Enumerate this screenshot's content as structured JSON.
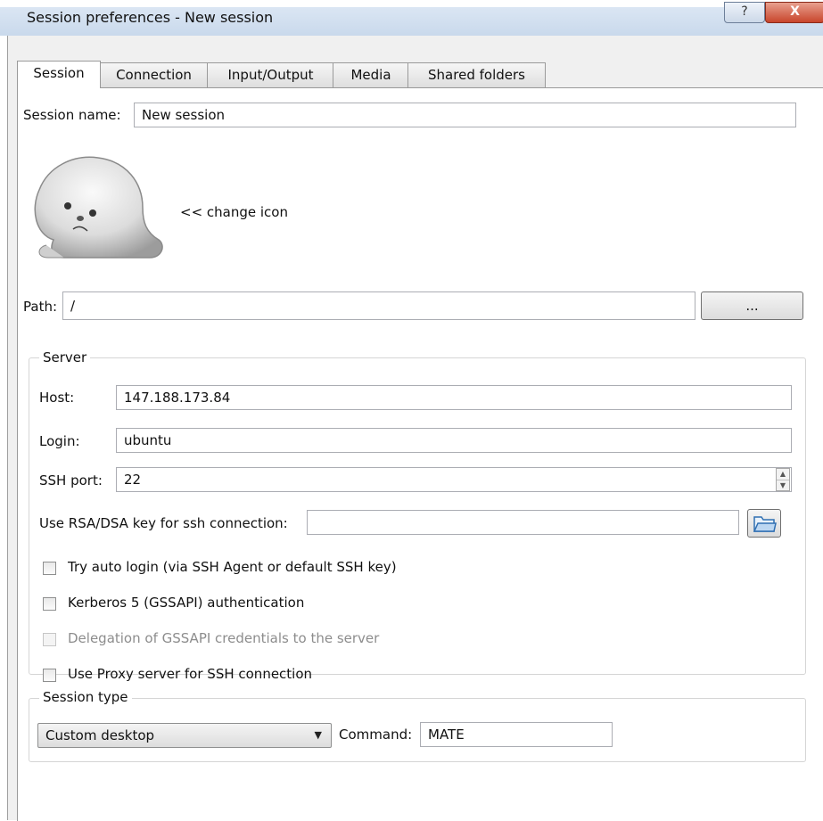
{
  "window": {
    "title": "Session preferences - New session",
    "help_label": "?",
    "close_label": "X"
  },
  "tabs": [
    {
      "label": "Session"
    },
    {
      "label": "Connection"
    },
    {
      "label": "Input/Output"
    },
    {
      "label": "Media"
    },
    {
      "label": "Shared folders"
    }
  ],
  "session": {
    "name_label": "Session name:",
    "name_value": "New session",
    "change_icon_label": "<< change icon",
    "path_label": "Path:",
    "path_value": "/",
    "browse_label": "..."
  },
  "server": {
    "group_title": "Server",
    "host_label": "Host:",
    "host_value": "147.188.173.84",
    "login_label": "Login:",
    "login_value": "ubuntu",
    "port_label": "SSH port:",
    "port_value": "22",
    "rsa_label": "Use RSA/DSA key for ssh connection:",
    "rsa_value": "",
    "checkboxes": [
      {
        "label": "Try auto login (via SSH Agent or default SSH key)",
        "checked": false,
        "enabled": true
      },
      {
        "label": "Kerberos 5 (GSSAPI) authentication",
        "checked": false,
        "enabled": true
      },
      {
        "label": "Delegation of GSSAPI credentials to the server",
        "checked": false,
        "enabled": false
      },
      {
        "label": "Use Proxy server for SSH connection",
        "checked": false,
        "enabled": true
      }
    ]
  },
  "session_type": {
    "group_title": "Session type",
    "selected": "Custom desktop",
    "command_label": "Command:",
    "command_value": "MATE"
  },
  "icons": {
    "session_icon": "seal-icon",
    "browse_folder": "folder-open-icon"
  }
}
